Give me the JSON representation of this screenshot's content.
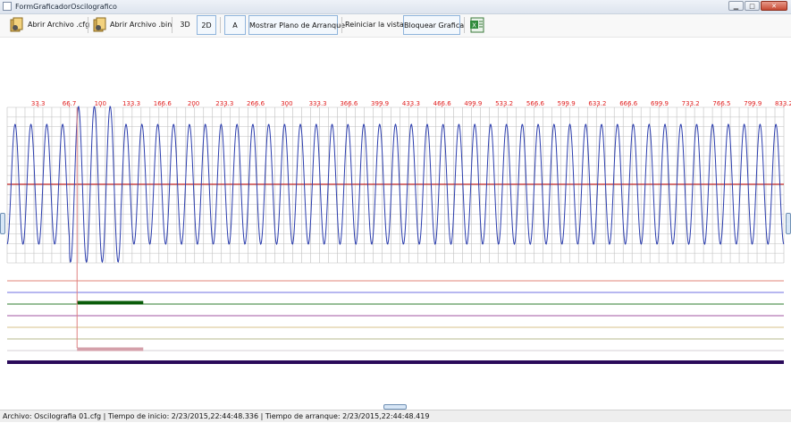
{
  "window": {
    "title": "FormGraficadorOscilografico",
    "minimize": "▁",
    "maximize": "□",
    "close": "✕"
  },
  "toolbar": {
    "open_cfg_label": "Abrir Archivo .cfg",
    "open_bin_label": "Abrir Archivo .bin",
    "btn_3d": "3D",
    "btn_2d": "2D",
    "btn_a": "A",
    "show_start_plane_label": "Mostrar Plano de Arranque",
    "reset_view_label": "Reiniciar la vista",
    "lock_chart_label": "Bloquear Grafica",
    "excel_icon": "excel-icon"
  },
  "chart_data": {
    "type": "line",
    "x_ticks": [
      "33.3",
      "66.7",
      "100",
      "133.3",
      "166.6",
      "200",
      "233.3",
      "266.6",
      "300",
      "333.3",
      "366.6",
      "399.9",
      "433.3",
      "466.6",
      "499.9",
      "533.2",
      "566.6",
      "599.9",
      "633.2",
      "666.6",
      "699.9",
      "733.2",
      "766.5",
      "799.9",
      "833.2"
    ],
    "x_max": 833.2,
    "cursor_x": 75,
    "waveform": {
      "cycles": 49,
      "normal_amplitude": 0.77,
      "fault_amplitude": 1.0,
      "fault_start_x": 67,
      "fault_end_x": 122,
      "color": "#2b3dad"
    },
    "channels": [
      {
        "color": "#e0857a",
        "active_start_x": null,
        "active_end_x": null
      },
      {
        "color": "#6f6fe0",
        "active_start_x": null,
        "active_end_x": null
      },
      {
        "color": "#2f7d2f",
        "active_start_x": 75,
        "active_end_x": 146,
        "active_color": "#0a5c0a"
      },
      {
        "color": "#a154a1",
        "active_start_x": null,
        "active_end_x": null
      },
      {
        "color": "#d7c08a",
        "active_start_x": null,
        "active_end_x": null
      },
      {
        "color": "#b7b98d",
        "active_start_x": null,
        "active_end_x": null
      },
      {
        "color": "#d6cfd6",
        "active_start_x": 75,
        "active_end_x": 146,
        "active_color": "#d4a0aa"
      },
      {
        "color": "#2a0a5a",
        "active_start_x": null,
        "active_end_x": null
      }
    ],
    "colors": {
      "tick_labels": "#e02020",
      "grid": "#bfbfbf",
      "axis": "#c00000",
      "cursor": "#e08080"
    }
  },
  "status": {
    "text": "Archivo: Oscilografia 01.cfg  |  Tiempo de inicio: 2/23/2015,22:44:48.336  |  Tiempo de arranque: 2/23/2015,22:44:48.419"
  }
}
